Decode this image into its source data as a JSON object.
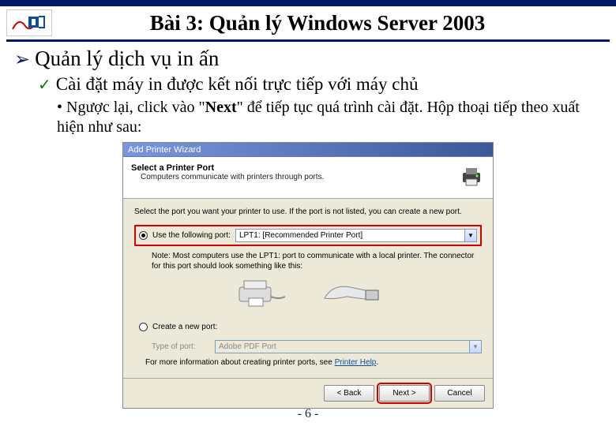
{
  "title": "Bài 3: Quản lý Windows Server 2003",
  "lvl1": "Quản lý dịch vụ in ấn",
  "lvl2": "Cài đặt máy in được kết nối trực tiếp với máy chủ",
  "lvl3_pre": "• Ngược lại, click vào \"",
  "lvl3_bold": "Next",
  "lvl3_post": "\" để tiếp tục quá trình cài đặt. Hộp thoại tiếp theo xuất hiện như sau:",
  "wizard": {
    "titlebar": "Add Printer Wizard",
    "head_title": "Select a Printer Port",
    "head_sub": "Computers communicate with printers through ports.",
    "desc": "Select the port you want your printer to use. If the port is not listed, you can create a new port.",
    "radio1_label": "Use the following port:",
    "combo1_value": "LPT1: [Recommended Printer Port]",
    "note": "Note: Most computers use the LPT1: port to communicate with a local printer. The connector for this port should look something like this:",
    "radio2_label": "Create a new port:",
    "sub_label": "Type of port:",
    "combo2_value": "Adobe PDF Port",
    "info_pre": "For more information about creating printer ports, see ",
    "info_link": "Printer Help",
    "btn_back": "< Back",
    "btn_next": "Next >",
    "btn_cancel": "Cancel"
  },
  "page_number": "- 6 -"
}
